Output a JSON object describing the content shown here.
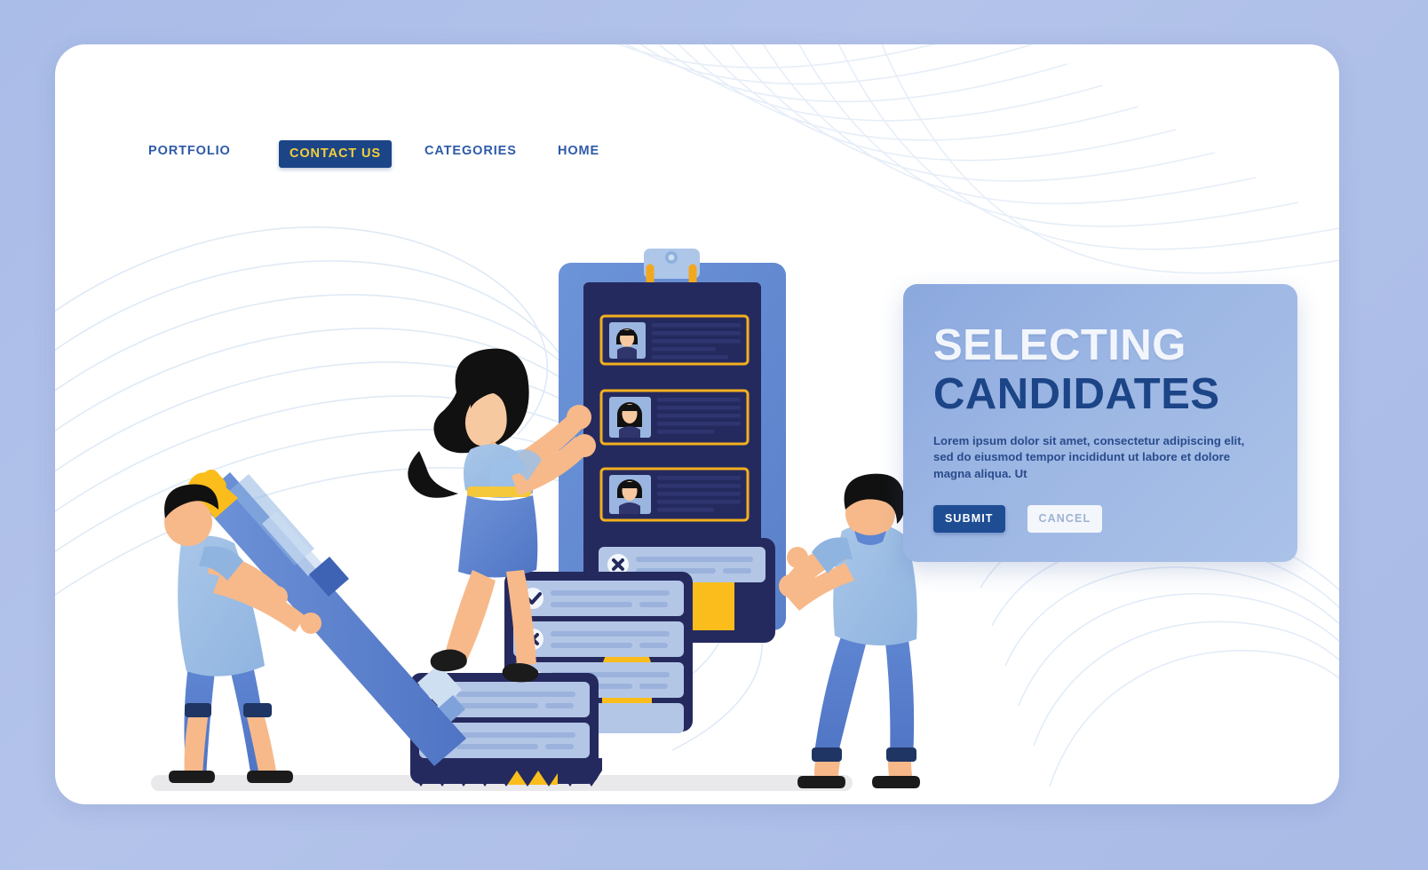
{
  "nav": {
    "items": [
      {
        "id": "portfolio",
        "label": "PORTFOLIO",
        "active": false
      },
      {
        "id": "contact",
        "label": "CONTACT US",
        "active": true
      },
      {
        "id": "categories",
        "label": "CATEGORIES",
        "active": false
      },
      {
        "id": "home",
        "label": "HOME",
        "active": false
      }
    ]
  },
  "panel": {
    "title_line1": "SELECTING",
    "title_line2": "CANDIDATES",
    "body": "Lorem ipsum dolor sit amet, consectetur adipiscing elit, sed do eiusmod tempor incididunt ut labore et dolore magna aliqua. Ut",
    "submit_label": "SUBMIT",
    "cancel_label": "CANCEL"
  },
  "illustration": {
    "clipboard": {
      "candidate_cards": 3,
      "list_rows": [
        "x",
        "check",
        "x",
        "check",
        "x",
        "check",
        "x",
        "check",
        "x",
        "check"
      ]
    },
    "characters": [
      "man-holding-pen",
      "woman-on-steps",
      "man-pushing-clipboard"
    ]
  },
  "colors": {
    "page_bg": "#a8bbe6",
    "card_bg": "#ffffff",
    "nav_text": "#2e5aa8",
    "nav_active_bg": "#1c4587",
    "nav_active_text": "#f3cf3c",
    "panel_title_light": "#f2f6fc",
    "panel_title_dark": "#1c4587",
    "accent_yellow": "#f9b81c",
    "deep_navy": "#252a5e",
    "mid_blue": "#5b7fce",
    "skin": "#f7b98a"
  }
}
